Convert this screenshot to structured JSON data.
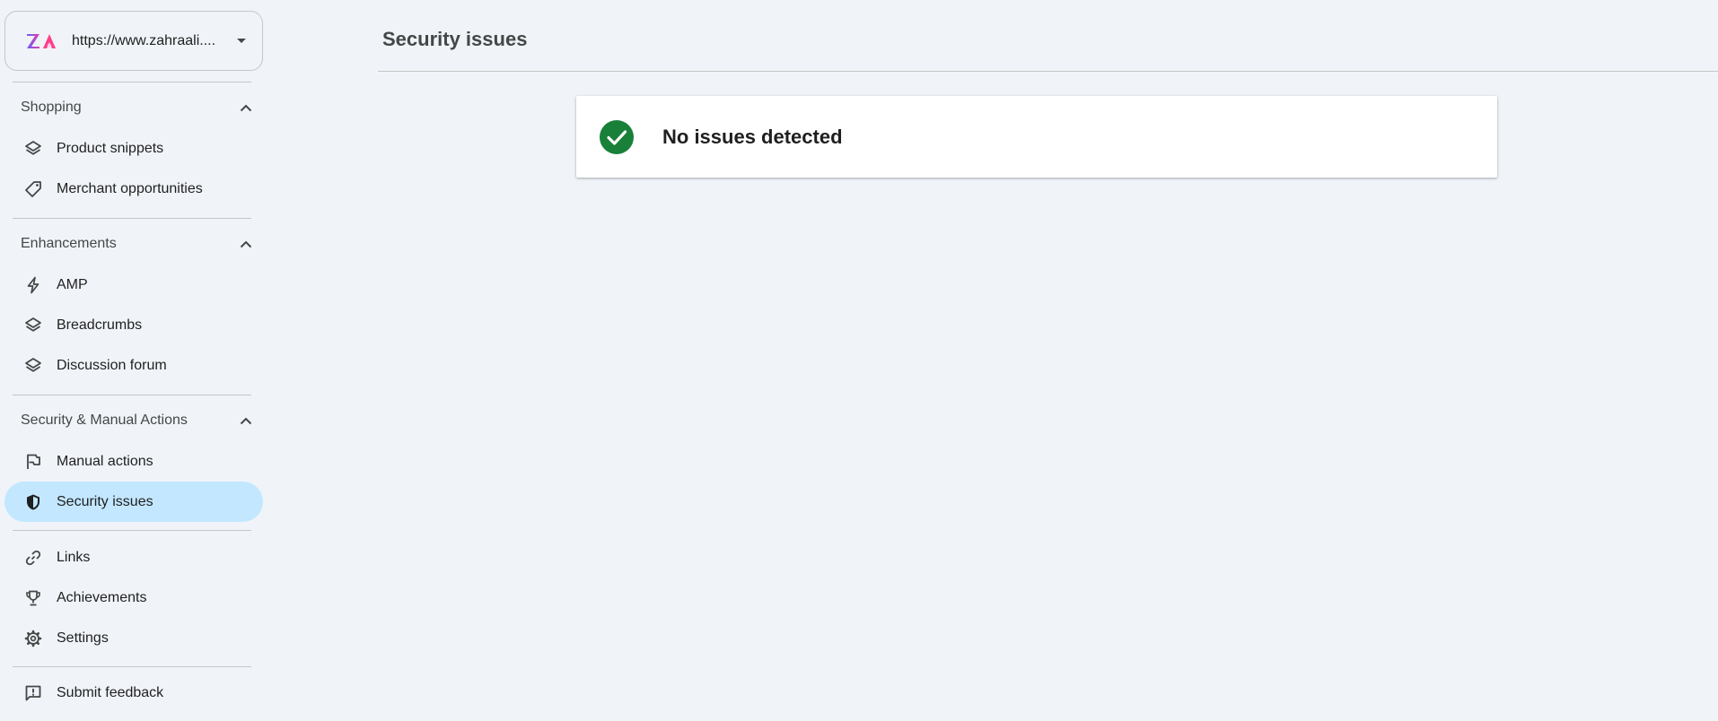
{
  "property": {
    "url": "https://www.zahraali....",
    "logo_icon": "za-logo-icon"
  },
  "sidebar": {
    "sections": [
      {
        "title": "Shopping",
        "items": [
          {
            "label": "Product snippets",
            "icon": "layers-icon"
          },
          {
            "label": "Merchant opportunities",
            "icon": "tag-icon"
          }
        ]
      },
      {
        "title": "Enhancements",
        "items": [
          {
            "label": "AMP",
            "icon": "bolt-icon"
          },
          {
            "label": "Breadcrumbs",
            "icon": "layers-icon"
          },
          {
            "label": "Discussion forum",
            "icon": "layers-icon"
          }
        ]
      },
      {
        "title": "Security & Manual Actions",
        "items": [
          {
            "label": "Manual actions",
            "icon": "flag-icon"
          },
          {
            "label": "Security issues",
            "icon": "shield-icon",
            "active": true
          }
        ]
      }
    ],
    "other_items": [
      {
        "label": "Links",
        "icon": "link-icon"
      },
      {
        "label": "Achievements",
        "icon": "trophy-icon"
      },
      {
        "label": "Settings",
        "icon": "gear-icon"
      }
    ],
    "feedback": {
      "label": "Submit feedback",
      "icon": "feedback-icon"
    }
  },
  "main": {
    "title": "Security issues",
    "status": {
      "text": "No issues detected",
      "icon": "check-circle-icon",
      "color": "#188038"
    }
  },
  "colors": {
    "background": "#f0f4f9",
    "active_item": "#c2e7ff",
    "divider": "#c4c7c5"
  }
}
